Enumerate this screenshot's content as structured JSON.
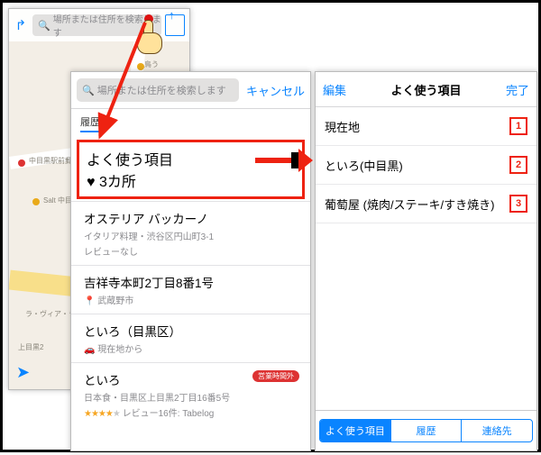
{
  "panel1": {
    "search_placeholder": "場所または住所を検索します",
    "map_labels": {
      "a": "鳥う",
      "b": "中目黒駅前郵便",
      "c": "Salt 中目黒店",
      "d": "ラ・ヴィア・ラ",
      "e": "上目黒2"
    }
  },
  "panel2": {
    "search_placeholder": "場所または住所を検索します",
    "cancel": "キャンセル",
    "segment": "履歴",
    "favorites": {
      "title": "よく使う項目",
      "sub": "3カ所"
    },
    "row1": {
      "title": "オステリア バッカーノ",
      "sub1": "イタリア料理・渋谷区円山町3-1",
      "sub2": "レビューなし"
    },
    "row2": {
      "title": "吉祥寺本町2丁目8番1号",
      "sub": "武蔵野市"
    },
    "row3": {
      "title": "といろ（目黒区）",
      "sub": "現在地から"
    },
    "row4": {
      "title": "といろ",
      "badge": "営業時間外",
      "sub1": "日本食・目黒区上目黒2丁目16番5号",
      "reviews": "レビュー16件: Tabelog"
    }
  },
  "panel3": {
    "edit": "編集",
    "title": "よく使う項目",
    "done": "完了",
    "items": [
      "現在地",
      "といろ(中目黒)",
      "葡萄屋 (焼肉/ステーキ/すき焼き)"
    ],
    "nums": [
      "1",
      "2",
      "3"
    ],
    "tabs": [
      "よく使う項目",
      "履歴",
      "連絡先"
    ]
  }
}
